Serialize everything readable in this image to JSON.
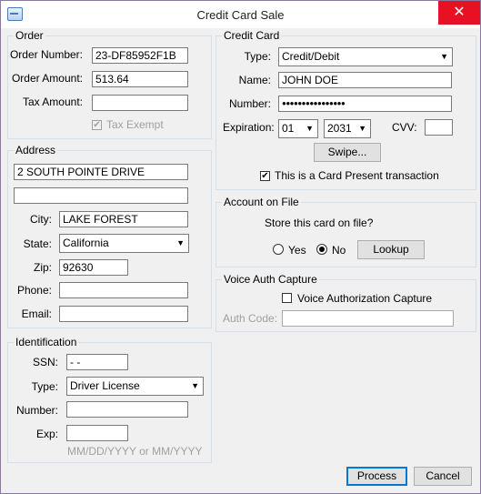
{
  "window": {
    "title": "Credit Card Sale",
    "close_glyph": "✕"
  },
  "order": {
    "legend": "Order",
    "number_label": "Order Number:",
    "number_value": "23-DF85952F1B",
    "amount_label": "Order Amount:",
    "amount_value": "513.64",
    "tax_label": "Tax Amount:",
    "tax_value": "",
    "tax_exempt_label": "Tax Exempt",
    "tax_exempt_checked": true
  },
  "address": {
    "legend": "Address",
    "line1": "2 SOUTH POINTE DRIVE",
    "line2": "",
    "city_label": "City:",
    "city_value": "LAKE FOREST",
    "state_label": "State:",
    "state_value": "California",
    "zip_label": "Zip:",
    "zip_value": "92630",
    "phone_label": "Phone:",
    "phone_value": "",
    "email_label": "Email:",
    "email_value": ""
  },
  "identification": {
    "legend": "Identification",
    "ssn_label": "SSN:",
    "ssn_value": " -  -",
    "type_label": "Type:",
    "type_value": "Driver License",
    "number_label": "Number:",
    "number_value": "",
    "exp_label": "Exp:",
    "exp_value": "",
    "exp_hint": "MM/DD/YYYY or MM/YYYY"
  },
  "credit_card": {
    "legend": "Credit Card",
    "type_label": "Type:",
    "type_value": "Credit/Debit",
    "name_label": "Name:",
    "name_value": "JOHN  DOE",
    "number_label": "Number:",
    "number_value": "●●●●●●●●●●●●●●●●",
    "expiration_label": "Expiration:",
    "exp_month": "01",
    "exp_year": "2031",
    "cvv_label": "CVV:",
    "cvv_value": "",
    "swipe_label": "Swipe...",
    "card_present_label": "This is a Card Present transaction",
    "card_present_checked": true
  },
  "account_on_file": {
    "legend": "Account on File",
    "question": "Store this card on file?",
    "yes_label": "Yes",
    "no_label": "No",
    "selected": "No",
    "lookup_label": "Lookup"
  },
  "voice_auth": {
    "legend": "Voice Auth Capture",
    "checkbox_label": "Voice Authorization Capture",
    "checked": false,
    "auth_code_label": "Auth Code:",
    "auth_code_value": ""
  },
  "actions": {
    "process_label": "Process",
    "cancel_label": "Cancel"
  },
  "icons": {
    "dropdown": "chevron-down-icon",
    "check": "checkmark-icon"
  },
  "colors": {
    "close": "#e81123",
    "default_button_border": "#0078d7"
  }
}
